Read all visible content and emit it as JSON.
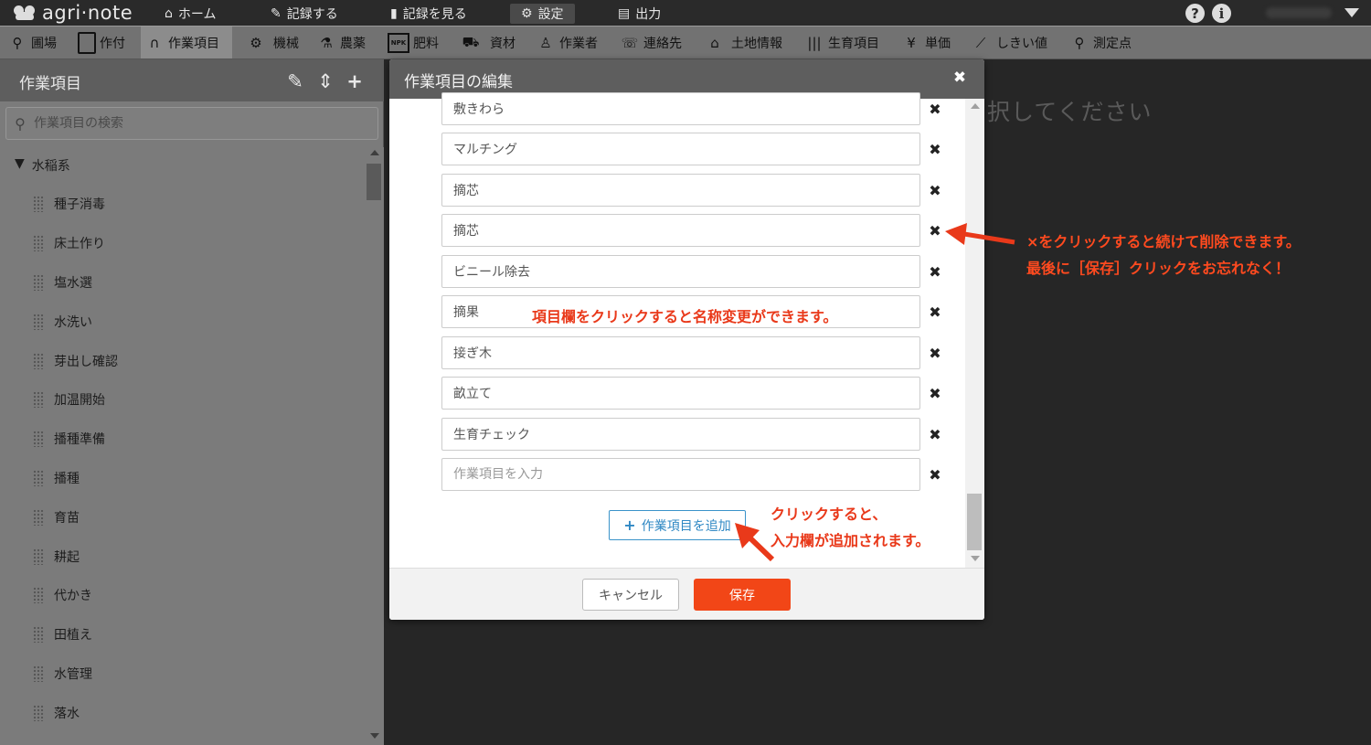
{
  "app": {
    "logo_text": "agri·note"
  },
  "topnav": {
    "items": [
      {
        "label": "ホーム",
        "icon": "home-icon",
        "active": false
      },
      {
        "label": "記録する",
        "icon": "pencil-icon",
        "active": false
      },
      {
        "label": "記録を見る",
        "icon": "book-icon",
        "active": false
      },
      {
        "label": "設定",
        "icon": "gear-icon",
        "active": true
      },
      {
        "label": "出力",
        "icon": "document-icon",
        "active": false
      }
    ],
    "help_label": "?",
    "info_label": "i"
  },
  "toolbar": {
    "items": [
      {
        "label": "圃場",
        "icon": "map-pin-icon"
      },
      {
        "label": "作付",
        "icon": "clipboard-icon"
      },
      {
        "label": "作業項目",
        "icon": "wave-icon",
        "active": true
      },
      {
        "label": "機械",
        "icon": "tractor-icon"
      },
      {
        "label": "農薬",
        "icon": "flask-icon"
      },
      {
        "label": "肥料",
        "icon": "npk-icon",
        "icon_text": "NPK"
      },
      {
        "label": "資材",
        "icon": "wheelbarrow-icon"
      },
      {
        "label": "作業者",
        "icon": "worker-icon"
      },
      {
        "label": "連絡先",
        "icon": "phonebook-icon"
      },
      {
        "label": "土地情報",
        "icon": "land-icon"
      },
      {
        "label": "生育項目",
        "icon": "growth-icon"
      },
      {
        "label": "単価",
        "icon": "yen-icon"
      },
      {
        "label": "しきい値",
        "icon": "line-chart-icon"
      },
      {
        "label": "測定点",
        "icon": "location-icon"
      }
    ]
  },
  "leftpanel": {
    "title": "作業項目",
    "search_placeholder": "作業項目の検索",
    "group_label": "水稲系",
    "group_arrow": "▼",
    "items": [
      "種子消毒",
      "床土作り",
      "塩水選",
      "水洗い",
      "芽出し確認",
      "加温開始",
      "播種準備",
      "播種",
      "育苗",
      "耕起",
      "代かき",
      "田植え",
      "水管理",
      "落水"
    ]
  },
  "background": {
    "prompt_text": "択してください"
  },
  "modal": {
    "title": "作業項目の編集",
    "close_label": "✖",
    "items": [
      {
        "value": "敷きわら",
        "placeholder": ""
      },
      {
        "value": "マルチング",
        "placeholder": ""
      },
      {
        "value": "摘芯",
        "placeholder": ""
      },
      {
        "value": "摘芯",
        "placeholder": ""
      },
      {
        "value": "ビニール除去",
        "placeholder": ""
      },
      {
        "value": "摘果",
        "placeholder": ""
      },
      {
        "value": "接ぎ木",
        "placeholder": ""
      },
      {
        "value": "畝立て",
        "placeholder": ""
      },
      {
        "value": "生育チェック",
        "placeholder": ""
      },
      {
        "value": "",
        "placeholder": "作業項目を入力"
      }
    ],
    "delete_label": "✖",
    "add_label": "作業項目を追加",
    "add_plus": "+",
    "cancel_label": "キャンセル",
    "save_label": "保存"
  },
  "annotations": {
    "rename_note": "項目欄をクリックすると名称変更ができます。",
    "delete_note_1": "×をクリックすると続けて削除できます。",
    "delete_note_2": "最後に［保存］クリックをお忘れなく！",
    "add_note_1": "クリックすると、",
    "add_note_2": "入力欄が追加されます。"
  },
  "colors": {
    "accent_save": "#f24617",
    "annotation_red": "#e9391a",
    "add_button_blue": "#2f88c4"
  }
}
